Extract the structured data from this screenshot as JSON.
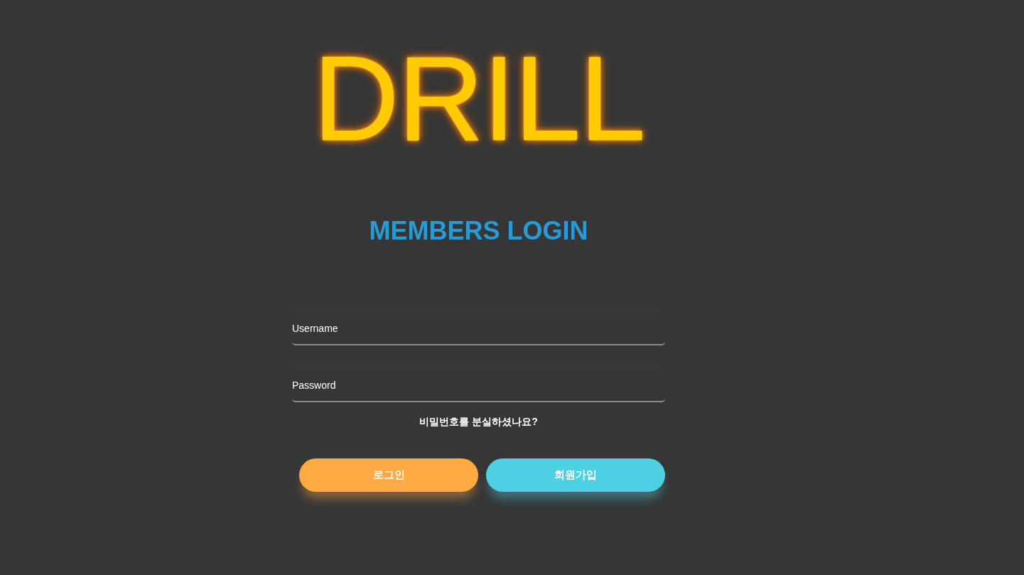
{
  "logo": {
    "text": "DRILL"
  },
  "heading": "MEMBERS LOGIN",
  "fields": [
    {
      "placeholder": "Username"
    },
    {
      "placeholder": "Password"
    }
  ],
  "forgot_link": "비밀번호를 분실하셨나요?",
  "buttons": [
    {
      "label": "로그인",
      "color": "#ffaa42"
    },
    {
      "label": "회원가입",
      "color": "#4dd0e1"
    }
  ]
}
